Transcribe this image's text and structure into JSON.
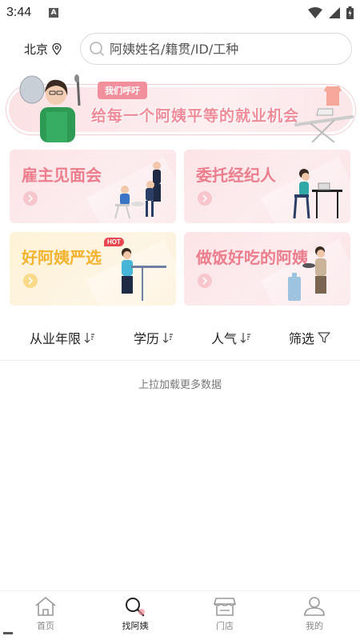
{
  "status_bar": {
    "time": "3:44",
    "notification_letter": "A"
  },
  "header": {
    "city": "北京",
    "search_placeholder": "阿姨姓名/籍贯/ID/工种"
  },
  "banner": {
    "tag": "我们呼吁",
    "title": "给每一个阿姨平等的就业机会"
  },
  "cards": [
    {
      "title": "雇主见面会"
    },
    {
      "title": "委托经纪人"
    },
    {
      "title": "好阿姨严选",
      "badge": "HOT"
    },
    {
      "title": "做饭好吃的阿姨"
    }
  ],
  "filters": [
    {
      "label": "从业年限"
    },
    {
      "label": "学历"
    },
    {
      "label": "人气"
    },
    {
      "label": "筛选"
    }
  ],
  "list": {
    "load_more": "上拉加载更多数据"
  },
  "tab_bar": {
    "active": "找阿姨",
    "tabs": [
      {
        "label": "首页",
        "icon": "home-icon"
      },
      {
        "label": "找阿姨",
        "icon": "search-auntie-icon"
      },
      {
        "label": "门店",
        "icon": "store-icon"
      },
      {
        "label": "我的",
        "icon": "profile-icon"
      }
    ]
  },
  "colors": {
    "pink_accent": "#ec7d8d",
    "yellow_accent": "#f3b22f",
    "card_pink_bg": "#fde4e6",
    "card_yellow_bg": "#fef3d7"
  }
}
